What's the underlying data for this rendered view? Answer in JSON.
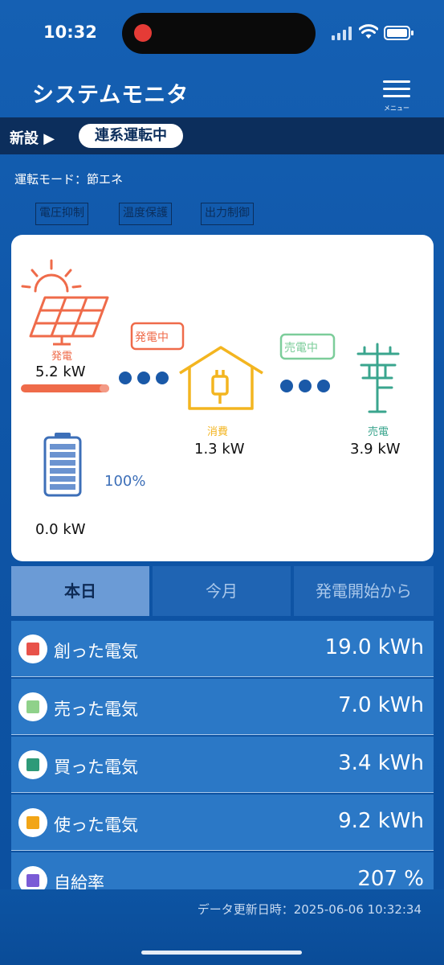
{
  "status_bar": {
    "time": "10:32"
  },
  "header": {
    "title": "システムモニタ",
    "menu_label": "メニュー"
  },
  "status_row": {
    "prefix": "新設 ▶",
    "state": "連系運転中"
  },
  "mode": "運転モード：節エネ",
  "feature_tags": [
    "電圧抑制",
    "温度保護",
    "出力制御"
  ],
  "energy_flow": {
    "generation": {
      "label": "発電",
      "value": "5.2 kW",
      "badge": "発電中"
    },
    "consumption": {
      "label": "消費",
      "value": "1.3 kW"
    },
    "sell": {
      "label": "売電",
      "value": "3.9 kW",
      "badge": "売電中"
    },
    "battery": {
      "level": "100%",
      "value": "0.0 kW",
      "level_fraction": 1.0
    }
  },
  "tabs": [
    {
      "label": "本日",
      "active": true
    },
    {
      "label": "今月",
      "active": false
    },
    {
      "label": "発電開始から",
      "active": false
    }
  ],
  "stats": [
    {
      "label": "創った電気",
      "value": "19.0 kWh",
      "color": "#e8524a"
    },
    {
      "label": "売った電気",
      "value": "7.0 kWh",
      "color": "#8fd18a"
    },
    {
      "label": "買った電気",
      "value": "3.4 kWh",
      "color": "#2e9a78"
    },
    {
      "label": "使った電気",
      "value": "9.2 kWh",
      "color": "#f2a516"
    },
    {
      "label": "自給率",
      "value": "207 %",
      "color": "#7a5bd6"
    }
  ],
  "footer": {
    "updated": "データ更新日時：2025-06-06 10:32:34"
  },
  "colors": {
    "solar": "#ef6b4a",
    "home": "#f3b520",
    "grid": "#3aa58e",
    "battery": "#3d6fb8",
    "dots": "#1a59a8"
  }
}
